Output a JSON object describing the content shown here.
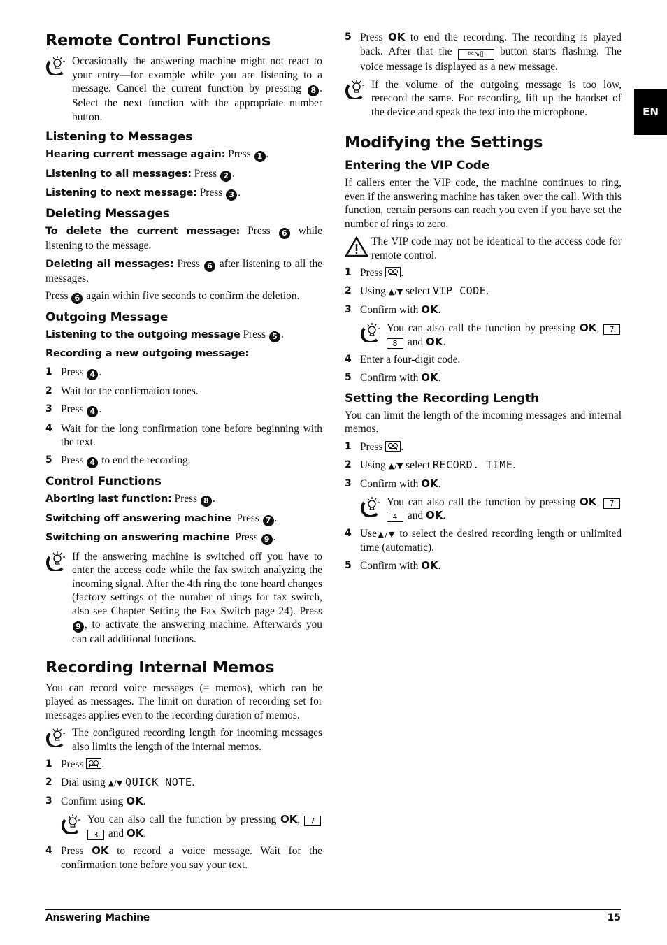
{
  "side_tab": "EN",
  "footer": {
    "section": "Answering Machine",
    "page_number": "15"
  },
  "ok": "OK",
  "arrows": "▲/▼",
  "left": {
    "title": "Remote Control Functions",
    "intro_tip": {
      "pre": "Occasionally the answering machine might not react to your entry—for example while you are listening to a message. Cancel the current function by pressing",
      "key": "8",
      "post": ". Select the next function with the appropriate number button."
    },
    "listening": {
      "heading": "Listening to Messages",
      "items": [
        {
          "label": "Hearing current message again:",
          "text": "Press",
          "key": "1"
        },
        {
          "label": "Listening to all messages:",
          "text": "Press",
          "key": "2"
        },
        {
          "label": "Listening to next message:",
          "text": "Press",
          "key": "3"
        }
      ]
    },
    "deleting": {
      "heading": "Deleting Messages",
      "item1": {
        "label": "To delete the current message:",
        "pre": "Press",
        "key": "6",
        "post": "while listening to the message."
      },
      "item2": {
        "label": "Deleting all messages:",
        "pre": "Press",
        "key": "6",
        "post": "after listening to all the messages."
      },
      "item3": {
        "pre": "Press",
        "key": "6",
        "post": "again within five seconds to confirm the deletion."
      }
    },
    "outgoing": {
      "heading": "Outgoing Message",
      "listen": {
        "label": "Listening to the outgoing message",
        "text": "Press",
        "key": "5"
      },
      "record_label": "Recording a new outgoing message:",
      "steps": [
        {
          "num": "1",
          "pre": "Press",
          "key": "4",
          "post": "."
        },
        {
          "num": "2",
          "pre": "Wait for the confirmation tones.",
          "key": null,
          "post": ""
        },
        {
          "num": "3",
          "pre": "Press",
          "key": "4",
          "post": "."
        },
        {
          "num": "4",
          "pre": "Wait for the long confirmation tone before beginning with the text.",
          "key": null,
          "post": ""
        },
        {
          "num": "5",
          "pre": "Press",
          "key": "4",
          "post": "to end the recording."
        }
      ]
    },
    "control": {
      "heading": "Control Functions",
      "items": [
        {
          "label": "Aborting last function:",
          "text": "Press",
          "key": "8"
        },
        {
          "label": "Switching off answering machine",
          "text": "Press",
          "key": "7"
        },
        {
          "label": "Switching on answering machine",
          "text": "Press",
          "key": "9"
        }
      ],
      "tip": {
        "pre": "If the answering machine is switched off you have to enter the access code while the fax switch analyzing the incoming signal. After the 4th ring the tone heard changes (factory settings of the number of rings for fax switch, also see Chapter Setting the Fax Switch page 24). Press",
        "key": "9",
        "post": ", to activate the answering machine. Afterwards you can call additional functions."
      }
    },
    "memos": {
      "title": "Recording Internal Memos",
      "intro": "You can record voice messages (= memos), which can be played as messages. The limit on duration of recording set for messages applies even to the recording duration of memos.",
      "tip": "The configured recording length for incoming messages also limits the length of the internal memos.",
      "step1": {
        "num": "1",
        "text": "Press"
      },
      "step2": {
        "num": "2",
        "pre": "Dial using",
        "lcd": "QUICK NOTE",
        "post": "."
      },
      "step3": {
        "num": "3",
        "pre": "Confirm using",
        "post": "."
      },
      "step3_tip": {
        "pre": "You can also call the function by pressing",
        "keys": [
          "7",
          "3"
        ],
        "and": "and"
      },
      "step4": {
        "num": "4",
        "pre": "Press",
        "post": "to record a voice message. Wait for the confirmation tone before you say your text."
      }
    }
  },
  "right": {
    "memo_step5": {
      "num": "5",
      "pre": "Press",
      "mid": "to end the recording. The recording is played back. After that the",
      "post": "button starts flashing. The voice message is displayed as a new message."
    },
    "volume_tip": "If the volume of the outgoing message is too low, rerecord the same. For recording, lift up the handset of the device and speak the text into the microphone.",
    "settings_title": "Modifying the Settings",
    "vip": {
      "heading": "Entering the VIP Code",
      "intro": "If callers enter the VIP code, the machine continues to ring, even if the answering machine has taken over the call. With this function, certain persons can reach you even if you have set the number of rings to zero.",
      "warning": "The VIP code may not be identical to the access code for remote control.",
      "step1": {
        "num": "1",
        "text": "Press"
      },
      "step2": {
        "num": "2",
        "pre": "Using",
        "mid": "select",
        "lcd": "VIP CODE",
        "post": "."
      },
      "step3": {
        "num": "3",
        "pre": "Confirm with",
        "post": "."
      },
      "tip": {
        "pre": "You can also call the function by pressing",
        "keys": [
          "7",
          "8"
        ],
        "and": "and"
      },
      "step4": {
        "num": "4",
        "text": "Enter a four-digit code."
      },
      "step5": {
        "num": "5",
        "pre": "Confirm with",
        "post": "."
      }
    },
    "rec_length": {
      "heading": "Setting the Recording Length",
      "intro": "You can limit the length of the incoming messages and internal memos.",
      "step1": {
        "num": "1",
        "text": "Press"
      },
      "step2": {
        "num": "2",
        "pre": "Using",
        "mid": "select",
        "lcd": "RECORD. TIME",
        "post": "."
      },
      "step3": {
        "num": "3",
        "pre": "Confirm with",
        "post": "."
      },
      "tip": {
        "pre": "You can also call the function by pressing",
        "keys": [
          "7",
          "4"
        ],
        "and": "and"
      },
      "step4": {
        "num": "4",
        "pre": "Use",
        "post": "to select the desired recording length or unlimited time (automatic)."
      },
      "step5": {
        "num": "5",
        "pre": "Confirm with",
        "post": "."
      }
    }
  }
}
